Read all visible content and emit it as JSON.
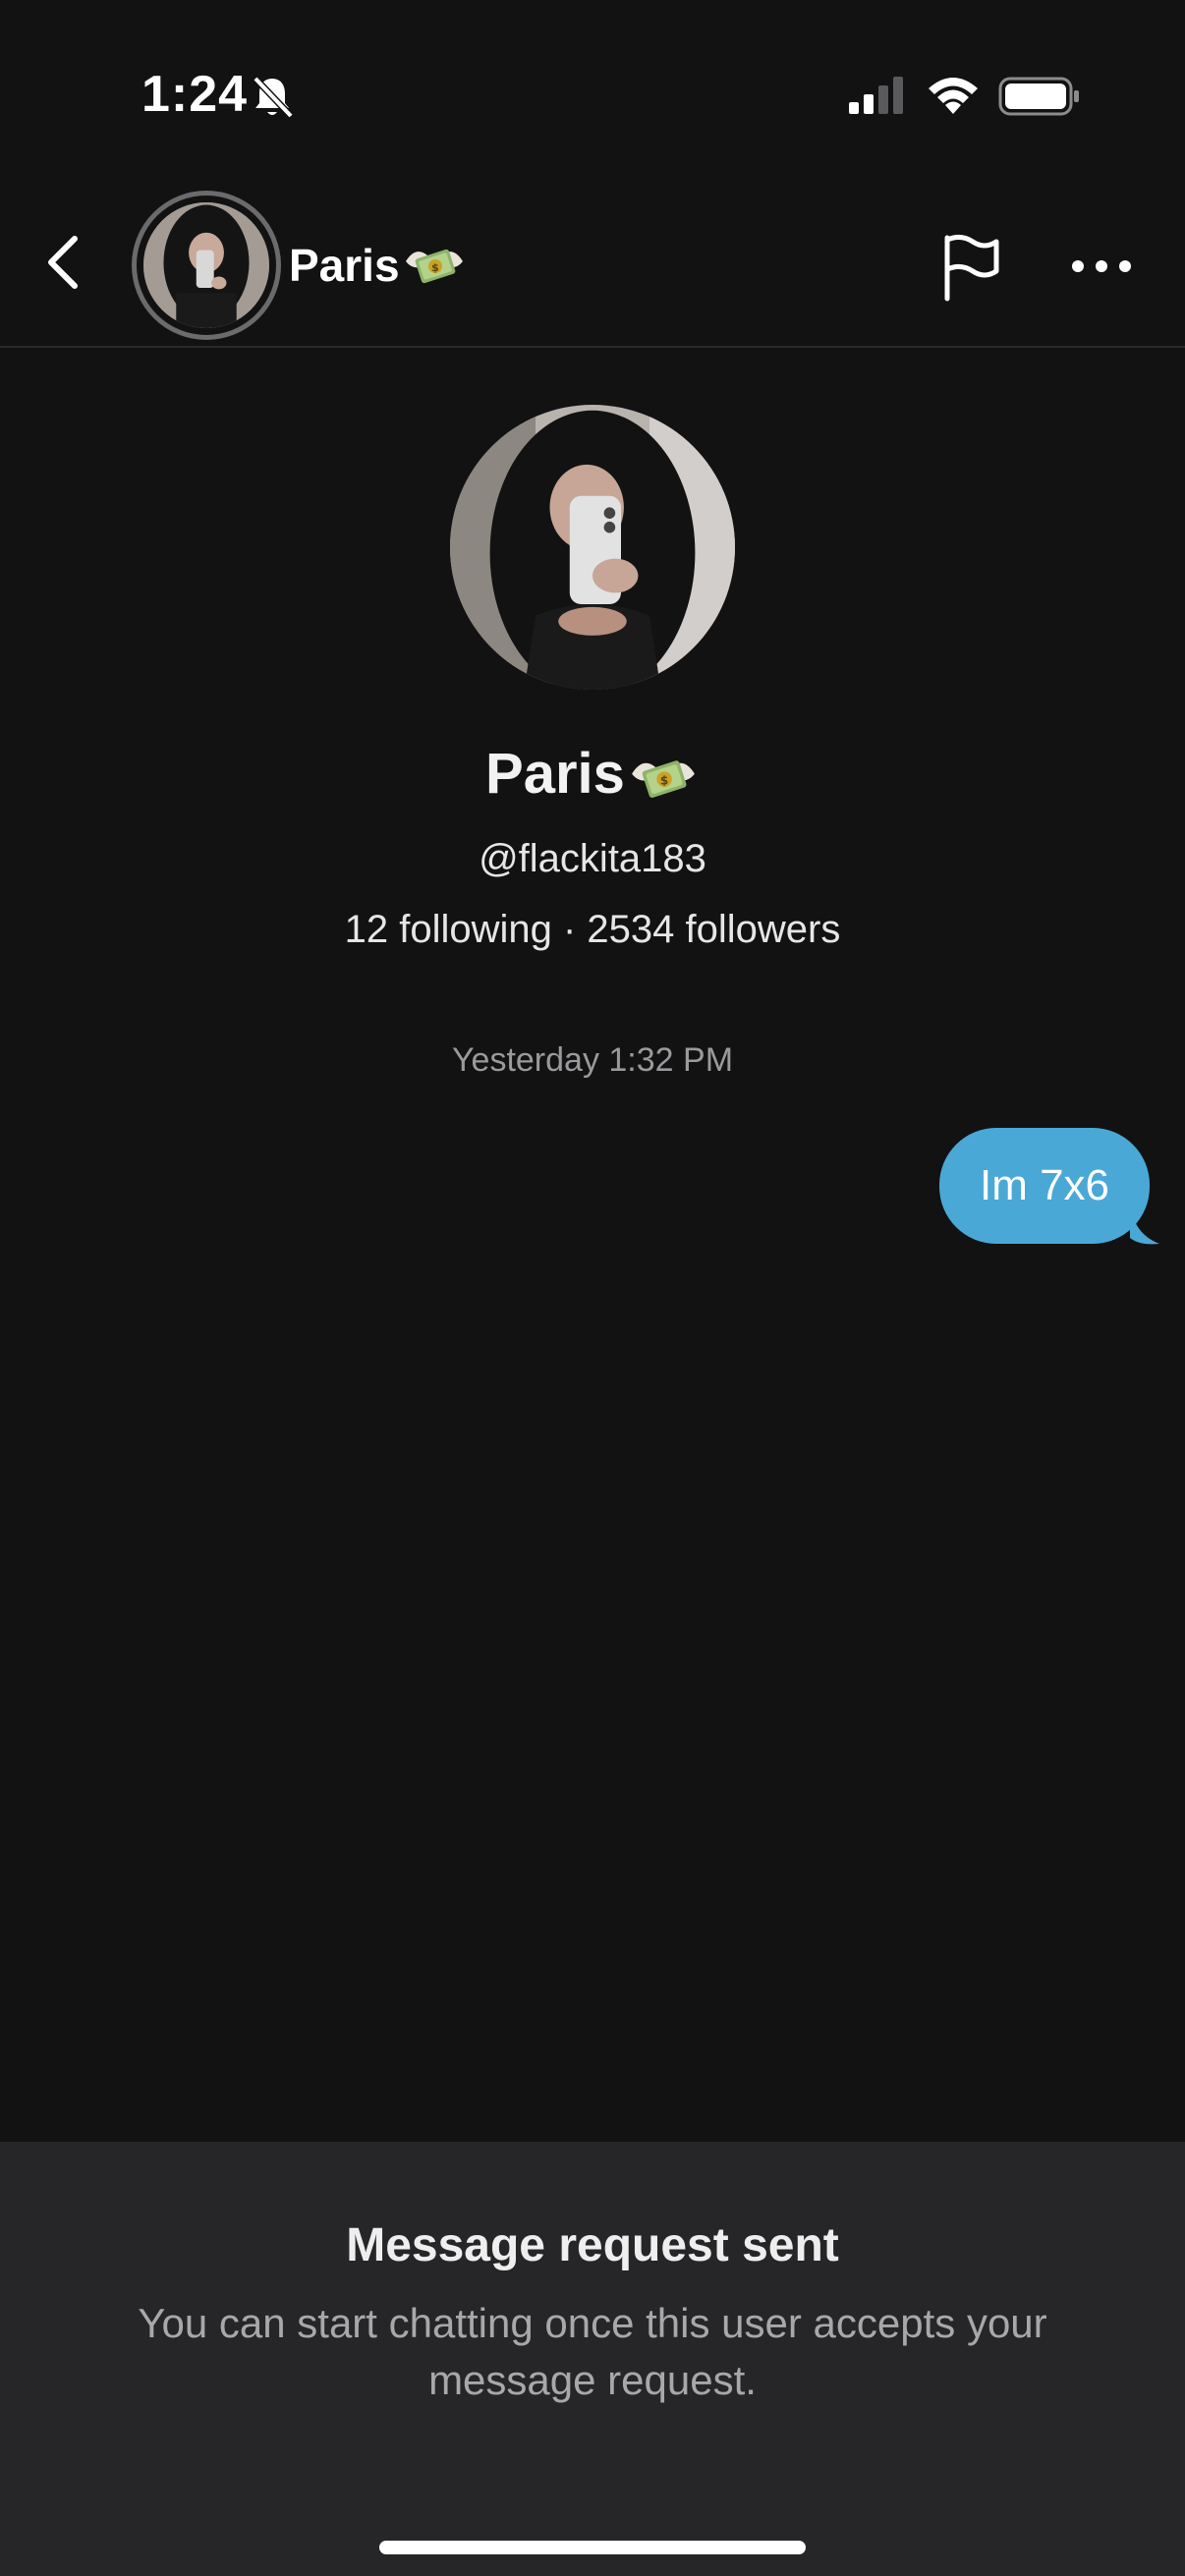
{
  "status_bar": {
    "time": "1:24",
    "icons": [
      "bell-slash-icon",
      "cellular-signal-icon",
      "wifi-icon",
      "battery-icon"
    ]
  },
  "header": {
    "back_icon": "chevron-left-icon",
    "name": "Paris",
    "name_emoji": "money-with-wings-emoji",
    "actions": [
      "flag-icon",
      "more-horizontal-icon"
    ]
  },
  "profile": {
    "name": "Paris",
    "handle": "@flackita183",
    "stats": "12 following · 2534 followers"
  },
  "conversation": {
    "timestamp": "Yesterday 1:32 PM",
    "messages": [
      {
        "from": "me",
        "text": "Im 7x6"
      }
    ],
    "bubble_color": "#4aa8d6"
  },
  "request_notice": {
    "title": "Message request sent",
    "body": "You can start chatting once this user accepts your message request."
  },
  "colors": {
    "background": "#121213",
    "panel": "#262628",
    "accent": "#4aa8d6"
  }
}
